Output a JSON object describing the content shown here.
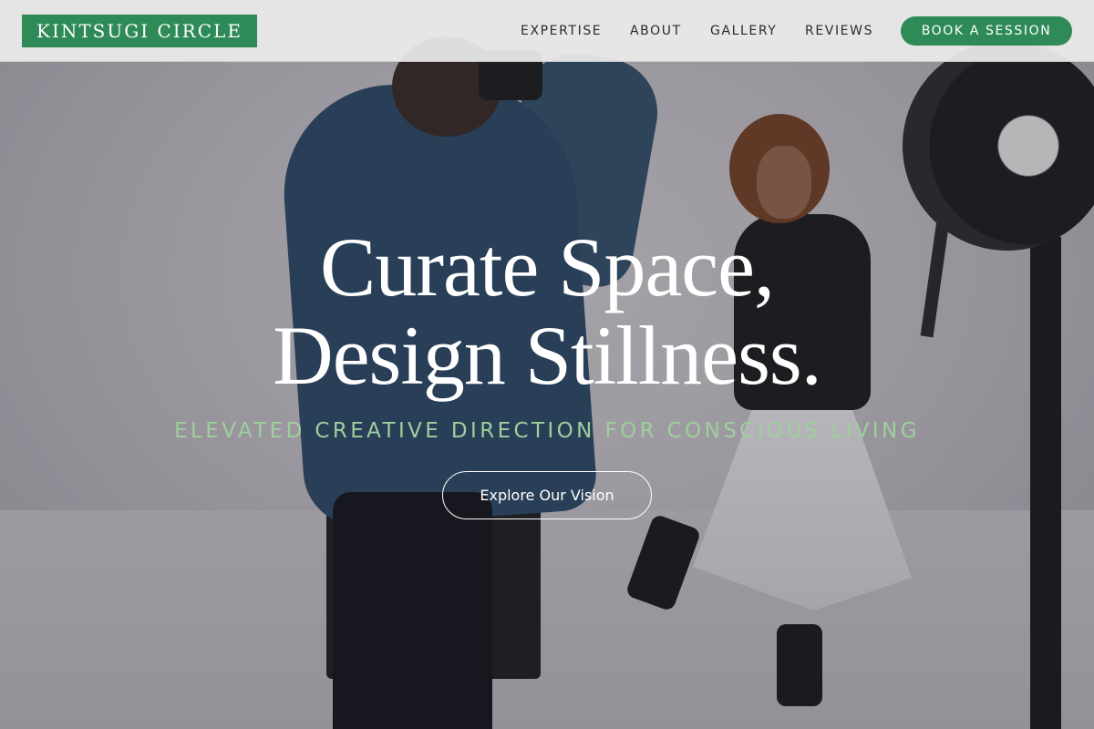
{
  "header": {
    "logo": "KINTSUGI CIRCLE",
    "nav": [
      "EXPERTISE",
      "ABOUT",
      "GALLERY",
      "REVIEWS"
    ],
    "cta": "BOOK A SESSION"
  },
  "hero": {
    "title_line_1": "Curate Space,",
    "title_line_2": "Design Stillness.",
    "subtitle": "ELEVATED CREATIVE DIRECTION FOR CONSCIOUS LIVING",
    "button": "Explore Our Vision"
  },
  "colors": {
    "brand_green": "#2e8b57",
    "subtitle_green": "#9ecf9c",
    "header_bg": "#ececec"
  }
}
